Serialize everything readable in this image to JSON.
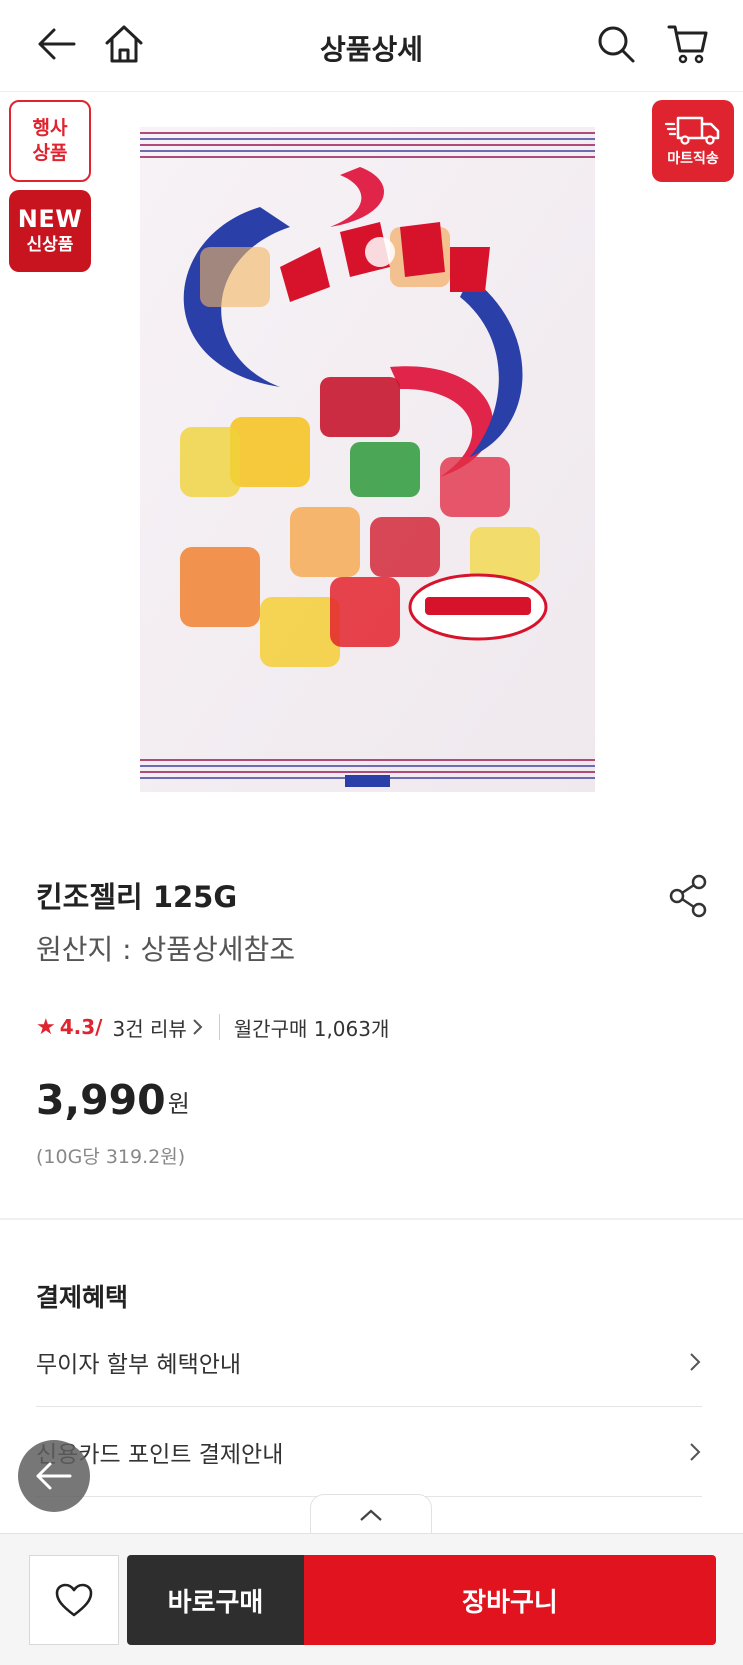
{
  "header": {
    "title": "상품상세",
    "back_icon": "back-arrow-icon",
    "home_icon": "home-icon",
    "search_icon": "search-icon",
    "cart_icon": "cart-icon"
  },
  "badges": {
    "event_line1": "행사",
    "event_line2": "상품",
    "new_line1": "NEW",
    "new_line2": "신상품",
    "mart_delivery": "마트직송"
  },
  "product": {
    "name": "킨조젤리 125G",
    "origin": "원산지 : 상품상세참조",
    "rating": "4.3/",
    "reviews": "3건 리뷰",
    "monthly_purchases": "월간구매 1,063개",
    "price": "3,990",
    "currency": "원",
    "unit_price": "(10G당 319.2원)"
  },
  "benefits": {
    "title": "결제혜택",
    "items": [
      {
        "label": "무이자 할부 혜택안내"
      },
      {
        "label": "신용카드 포인트 결제안내"
      }
    ]
  },
  "bottom_bar": {
    "buy_now": "바로구매",
    "add_to_cart": "장바구니"
  },
  "colors": {
    "brand_red": "#e0242f",
    "dark_button": "#2e2e2e"
  }
}
